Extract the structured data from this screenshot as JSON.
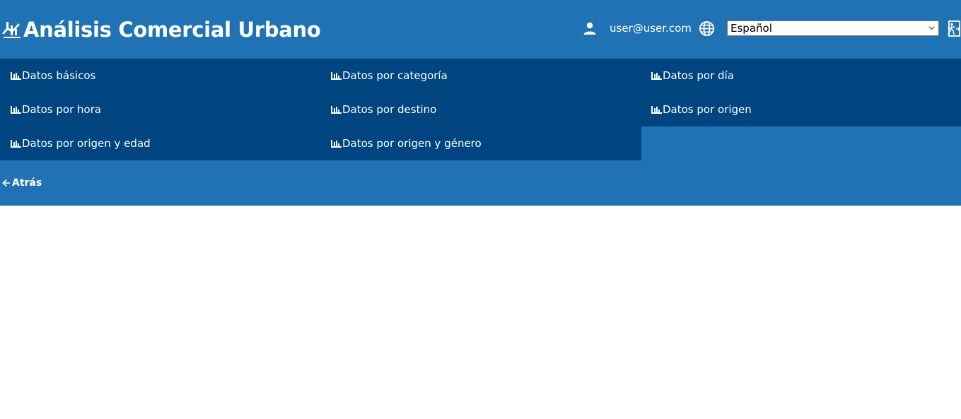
{
  "header": {
    "title": "Análisis Comercial Urbano",
    "user_email": "user@user.com",
    "language": "Español"
  },
  "menu": {
    "items": [
      {
        "label": "Datos básicos"
      },
      {
        "label": "Datos por categoría"
      },
      {
        "label": "Datos por día"
      },
      {
        "label": "Datos por hora"
      },
      {
        "label": "Datos por destino"
      },
      {
        "label": "Datos por origen"
      },
      {
        "label": "Datos por origen y edad"
      },
      {
        "label": "Datos por origen y género"
      }
    ]
  },
  "nav": {
    "back_label": "Atrás"
  },
  "colors": {
    "header_bg": "#1f72b4",
    "menu_item_bg": "#004480",
    "text": "#ffffff"
  },
  "icons": {
    "brand": "analytics-icon",
    "user": "user-icon",
    "language": "globe-icon",
    "logout": "exit-icon",
    "menu": "bar-chart-icon",
    "back": "arrow-left-icon"
  }
}
